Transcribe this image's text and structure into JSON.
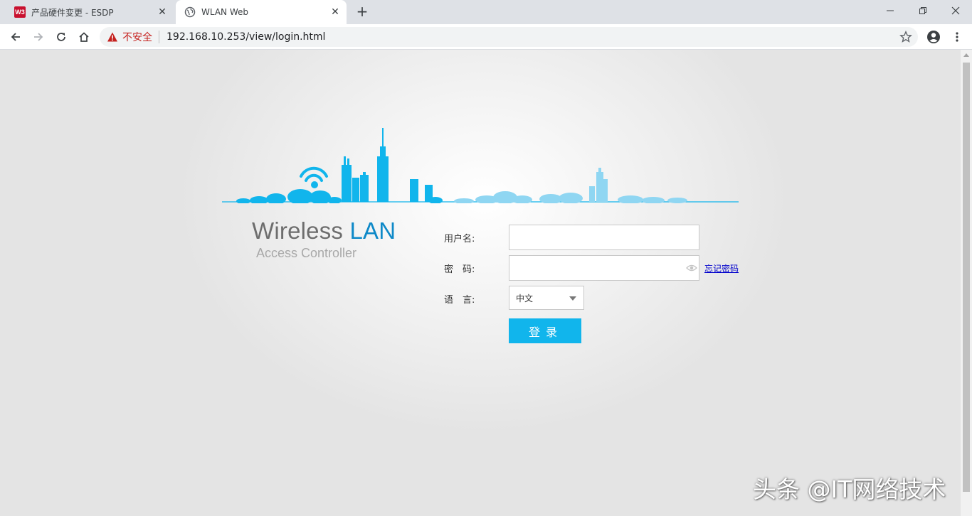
{
  "browser": {
    "tabs": [
      {
        "label": "产品硬件变更 - ESDP",
        "favicon": "w3-logo",
        "favicon_text": "W3",
        "active": false
      },
      {
        "label": "WLAN Web",
        "favicon": "globe-icon",
        "active": true
      }
    ],
    "new_tab_glyph": "+",
    "address": {
      "security_text": "不安全",
      "url": "192.168.10.253/view/login.html"
    }
  },
  "login": {
    "brand": {
      "title_part1": "Wireless",
      "title_part2": "LAN",
      "subtitle": "Access Controller"
    },
    "username_label": "用户名:",
    "username_value": "",
    "password_label": "密　码:",
    "password_value": "",
    "forgot_password": "忘记密码",
    "language_label": "语　言:",
    "language_selected": "中文",
    "login_button": "登录"
  },
  "watermark": "头条 @IT网络技术",
  "colors": {
    "accent": "#11b5ec",
    "brand_blue": "#0e89c8",
    "skyline": "#11b5ec",
    "insecure_red": "#c5221f"
  }
}
